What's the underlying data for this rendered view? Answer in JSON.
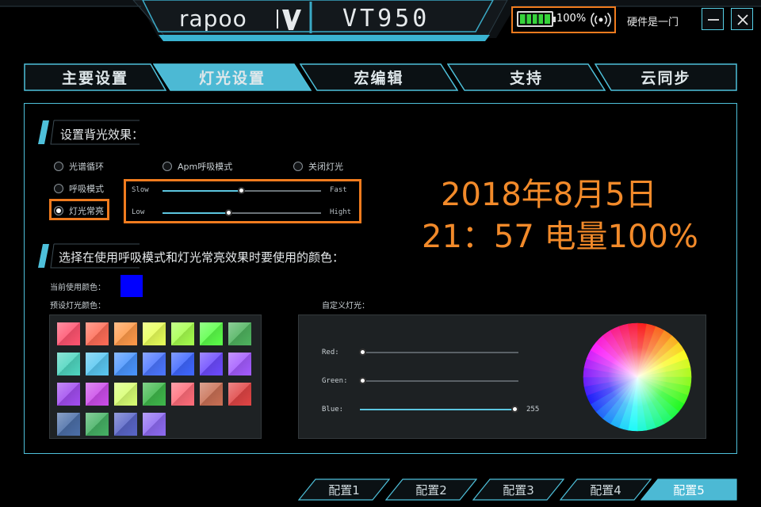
{
  "header": {
    "brand": "rapoo",
    "model": "VT950",
    "battery_pct": "100%",
    "battery_level": 1.0,
    "wireless_icon": "wireless-signal-icon",
    "hardware_label": "硬件是一门",
    "minimize_icon": "minimize-icon",
    "close_icon": "close-icon"
  },
  "tabs": [
    {
      "label": "主要设置",
      "active": false
    },
    {
      "label": "灯光设置",
      "active": true
    },
    {
      "label": "宏编辑",
      "active": false
    },
    {
      "label": "支持",
      "active": false
    },
    {
      "label": "云同步",
      "active": false
    }
  ],
  "backlight": {
    "title": "设置背光效果：",
    "modes": {
      "spectrum": "光谱循环",
      "breathing": "呼吸模式",
      "steady": "灯光常亮",
      "apm": "Apm呼吸模式",
      "off": "关闭灯光"
    },
    "selected": "steady",
    "speed": {
      "min_label": "Slow",
      "max_label": "Fast",
      "value": 0.5
    },
    "brightness": {
      "min_label": "Low",
      "max_label": "Hight",
      "value": 0.42
    }
  },
  "annotation": {
    "line1": "2018年8月5日",
    "line2": "21：57 电量100%"
  },
  "color_section": {
    "title": "选择在使用呼吸模式和灯光常亮效果时要使用的颜色：",
    "current_label": "当前使用颜色：",
    "current_color": "#0000ff",
    "preset_label": "预设灯光颜色：",
    "custom_label": "自定义灯光：",
    "presets": [
      "#ff5470",
      "#ff6d57",
      "#ff9a4a",
      "#e8ff5a",
      "#a6ff4e",
      "#5cff4a",
      "#4fb35f",
      "#4fd6c0",
      "#5ac8f2",
      "#4a95ff",
      "#4c76ff",
      "#3f67ff",
      "#6d4bff",
      "#a45cff",
      "#a24df0",
      "#cc4dea",
      "#d8ff73",
      "#3fb84b",
      "#ff6d7a",
      "#c97055",
      "#e04545",
      "#4c6fa8",
      "#46b265",
      "#5a66c8",
      "#8e6bf2"
    ],
    "sliders": {
      "red": {
        "label": "Red:",
        "value": 0
      },
      "green": {
        "label": "Green:",
        "value": 0
      },
      "blue": {
        "label": "Blue:",
        "value": 255,
        "value_text": "255"
      }
    },
    "wheel_icon": "color-wheel"
  },
  "profiles": [
    {
      "label": "配置1",
      "active": false
    },
    {
      "label": "配置2",
      "active": false
    },
    {
      "label": "配置3",
      "active": false
    },
    {
      "label": "配置4",
      "active": false
    },
    {
      "label": "配置5",
      "active": true
    }
  ],
  "colors": {
    "accent": "#4ec0da",
    "highlight": "#f07b1e",
    "battery": "#36d33a"
  }
}
